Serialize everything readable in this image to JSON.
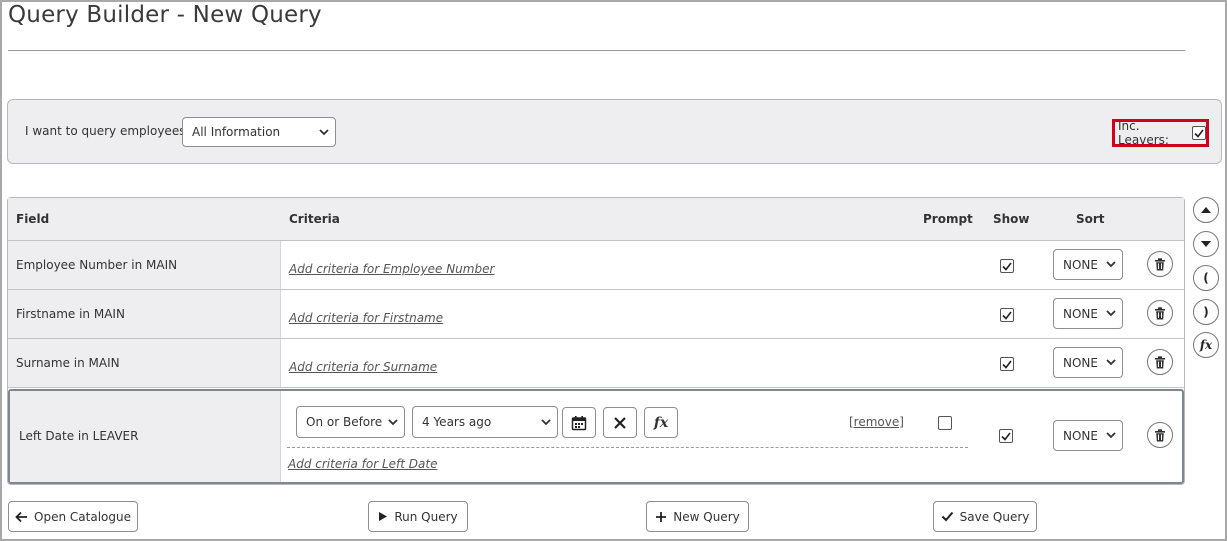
{
  "page": {
    "title": "Query Builder - New Query"
  },
  "query_bar": {
    "label": "I want to query employees:",
    "scope_value": "All Information",
    "inc_leavers_label": "Inc. Leavers:",
    "inc_leavers_checked": true
  },
  "table": {
    "headers": {
      "field": "Field",
      "criteria": "Criteria",
      "prompt": "Prompt",
      "show": "Show",
      "sort": "Sort"
    },
    "rows": [
      {
        "field": "Employee Number in MAIN",
        "criteria_link": "Add criteria for Employee Number",
        "show": true,
        "sort": "NONE"
      },
      {
        "field": "Firstname in MAIN",
        "criteria_link": "Add criteria for Firstname",
        "show": true,
        "sort": "NONE"
      },
      {
        "field": "Surname in MAIN",
        "criteria_link": "Add criteria for Surname",
        "show": true,
        "sort": "NONE"
      },
      {
        "field": "Left Date in LEAVER",
        "operator": "On or Before",
        "value": "4 Years ago",
        "remove_label": "[remove]",
        "prompt": false,
        "criteria_link": "Add criteria for Left Date",
        "show": true,
        "sort": "NONE"
      }
    ]
  },
  "side_controls": {
    "open_paren": "(",
    "close_paren": ")",
    "fx_label": "fx"
  },
  "buttons": {
    "open_catalogue": "Open Catalogue",
    "run_query": "Run Query",
    "new_query": "New Query",
    "save_query": "Save Query"
  },
  "colors": {
    "highlight": "#d0021b",
    "panel_bg": "#eeeef0",
    "border": "#b9b9bd"
  }
}
